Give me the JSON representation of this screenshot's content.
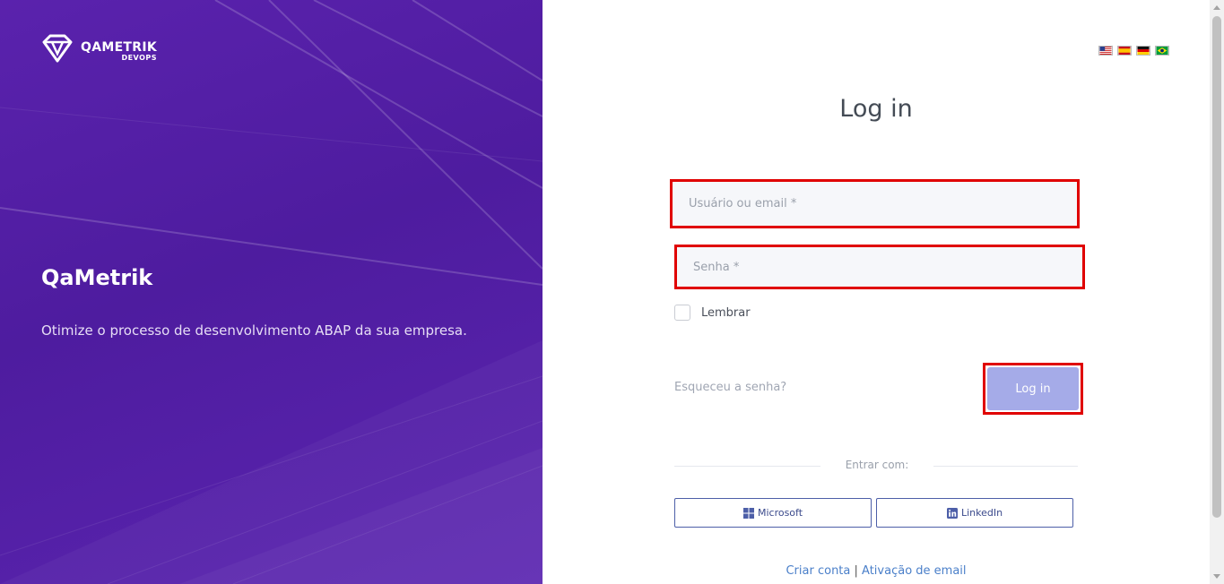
{
  "brand": {
    "logo_name": "QAMETRIK",
    "logo_sub": "DEVOPS",
    "title": "QaMetrik",
    "tagline": "Otimize o processo de desenvolvimento ABAP da sua empresa."
  },
  "languages": [
    {
      "icon": "flag-us-icon"
    },
    {
      "icon": "flag-es-icon"
    },
    {
      "icon": "flag-de-icon"
    },
    {
      "icon": "flag-br-icon"
    }
  ],
  "login": {
    "heading": "Log in",
    "username_placeholder": "Usuário ou email *",
    "username_value": "",
    "password_placeholder": "Senha *",
    "password_value": "",
    "remember_label": "Lembrar",
    "remember_checked": false,
    "forgot_label": "Esqueceu a senha?",
    "submit_label": "Log in",
    "divider_label": "Entrar com:"
  },
  "social": {
    "microsoft_label": "Microsoft",
    "linkedin_label": "LinkedIn"
  },
  "footer": {
    "create_account": "Criar conta",
    "separator": "|",
    "email_activation": "Ativação de email"
  },
  "colors": {
    "brand_purple": "#5a22ad",
    "highlight_red": "#e00000",
    "login_button": "#a5abe8",
    "social_border": "#4d5fa8",
    "link_blue": "#4a7fc9"
  }
}
